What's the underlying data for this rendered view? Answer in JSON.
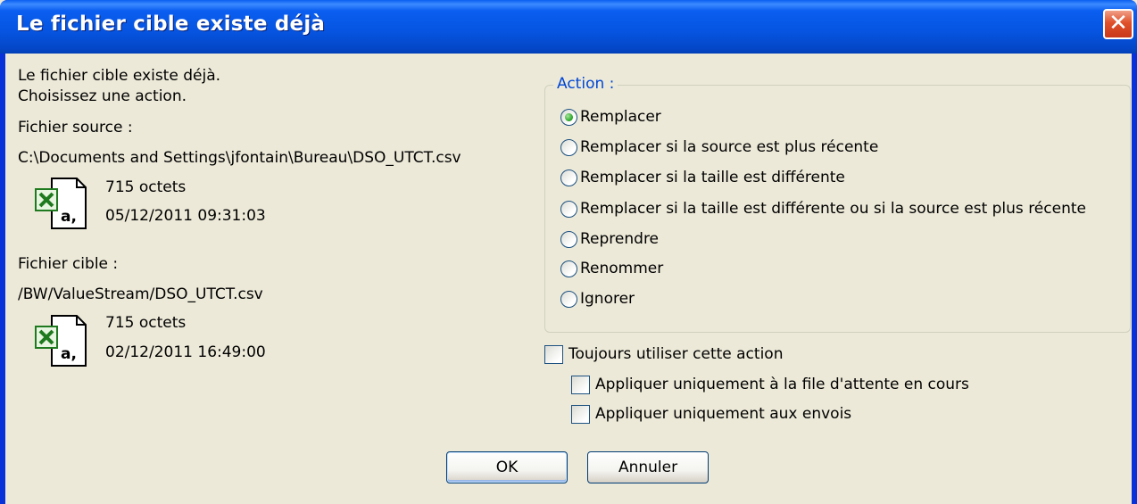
{
  "window": {
    "title": "Le fichier cible existe déjà",
    "close_glyph": "✕"
  },
  "message": {
    "line1": "Le fichier cible existe déjà.",
    "line2": "Choisissez une action."
  },
  "source": {
    "label": "Fichier source :",
    "path": "C:\\Documents and Settings\\jfontain\\Bureau\\DSO_UTCT.csv",
    "size": "715 octets",
    "date": "05/12/2011 09:31:03",
    "icon": "excel-csv-file-icon"
  },
  "target": {
    "label": "Fichier cible :",
    "path": "/BW/ValueStream/DSO_UTCT.csv",
    "size": "715 octets",
    "date": "02/12/2011 16:49:00",
    "icon": "excel-csv-file-icon"
  },
  "action_group": {
    "legend": "Action :",
    "options": [
      {
        "label": "Remplacer",
        "checked": true
      },
      {
        "label": "Remplacer si la source est plus récente",
        "checked": false
      },
      {
        "label": "Remplacer si la taille est différente",
        "checked": false
      },
      {
        "label": "Remplacer si la taille est différente ou si la source est plus récente",
        "checked": false
      },
      {
        "label": "Reprendre",
        "checked": false
      },
      {
        "label": "Renommer",
        "checked": false
      },
      {
        "label": "Ignorer",
        "checked": false
      }
    ]
  },
  "checkboxes": {
    "always": {
      "label": "Toujours utiliser cette action",
      "checked": false
    },
    "queue_only": {
      "label": "Appliquer uniquement à la file d'attente en cours",
      "checked": false
    },
    "uploads_only": {
      "label": "Appliquer uniquement aux envois",
      "checked": false
    }
  },
  "buttons": {
    "ok": "OK",
    "cancel": "Annuler"
  },
  "colors": {
    "title_bar": "#0a5ef0",
    "dialog_bg": "#ece9d8",
    "legend_text": "#0046d5",
    "close_button": "#e0502a"
  }
}
